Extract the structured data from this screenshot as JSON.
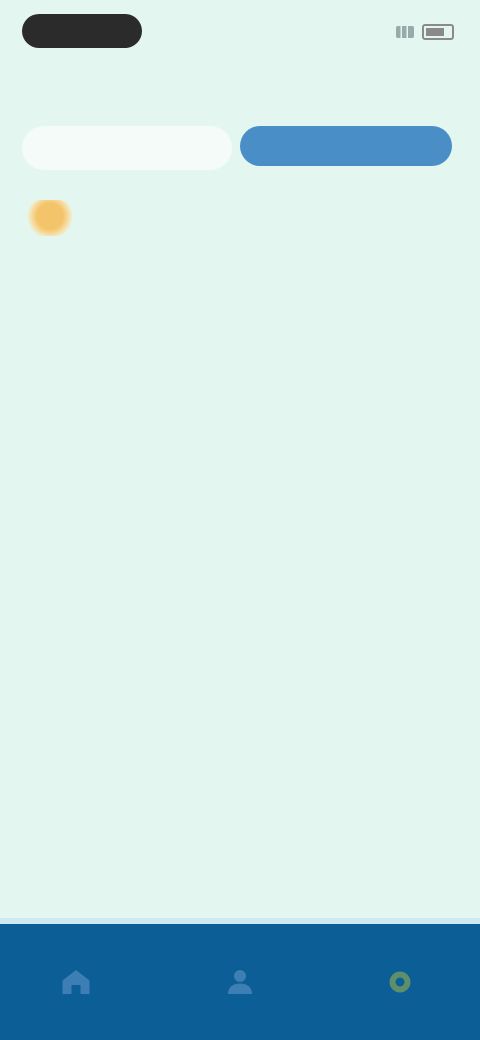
{
  "status": {
    "time": "",
    "signal_icon": "signal-icon",
    "battery_icon": "battery-icon"
  },
  "header": {
    "title": ""
  },
  "tabs": [
    {
      "label": ""
    },
    {
      "label": ""
    }
  ],
  "actions": {
    "primary_label": ""
  },
  "info": {
    "left": "",
    "right": ""
  },
  "empty_state": {
    "message": ""
  },
  "nav": [
    {
      "icon": "home-icon"
    },
    {
      "icon": "user-icon"
    },
    {
      "icon": "settings-icon"
    }
  ],
  "colors": {
    "background": "#e3f7f0",
    "accent": "#4a8ec7",
    "nav_bg": "#0b5e96"
  }
}
